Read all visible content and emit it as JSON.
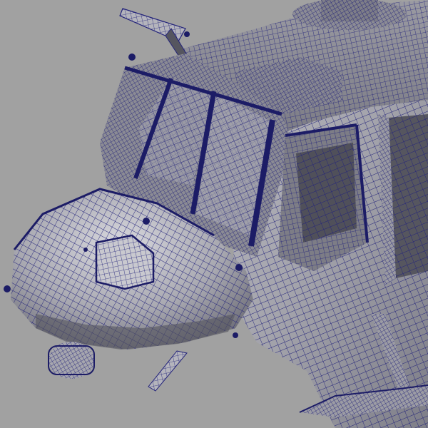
{
  "viewport": {
    "background_color": "#a1a1a1",
    "wire_color": "#23237a",
    "shade_light": "#c9c9cf",
    "shade_mid": "#9e9ea6",
    "shade_dark": "#55555f"
  }
}
